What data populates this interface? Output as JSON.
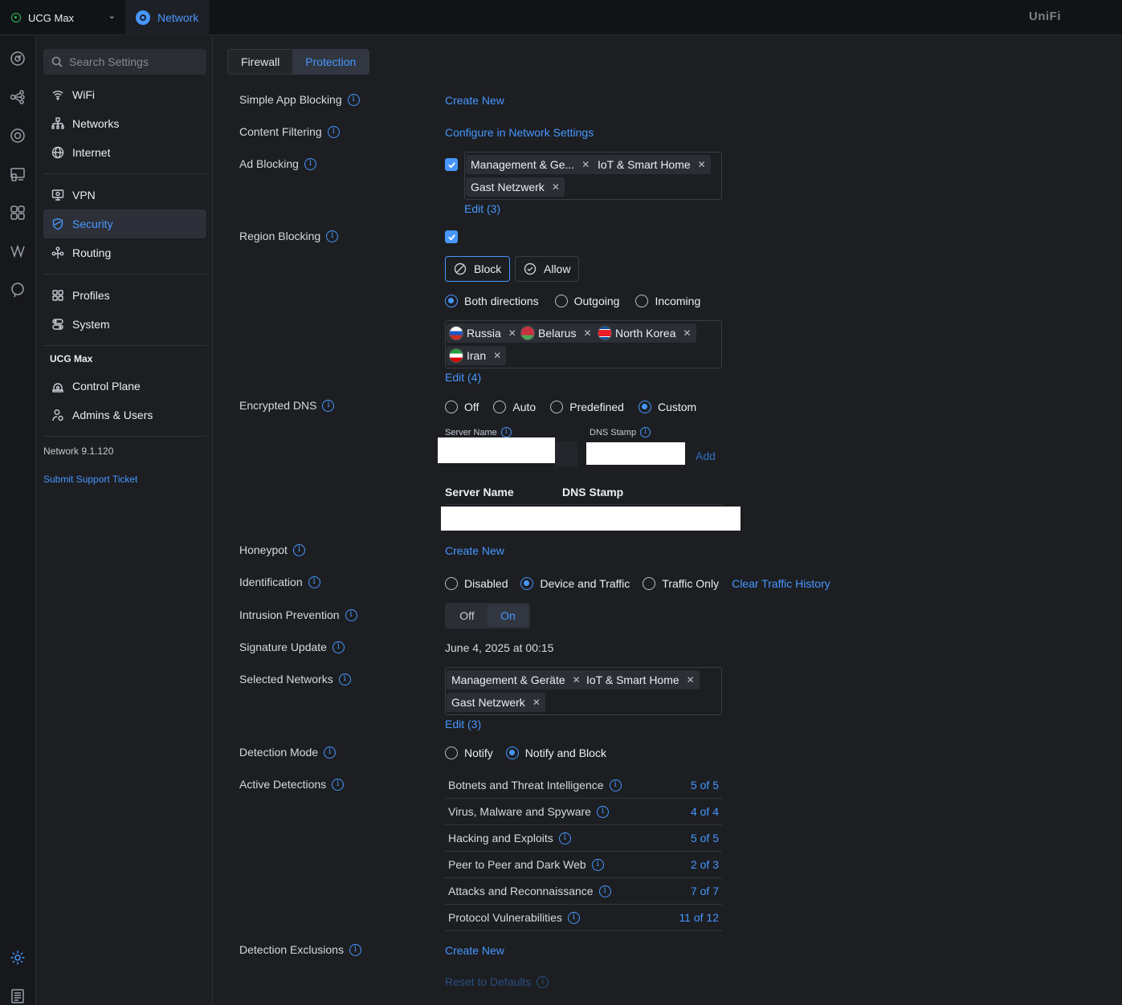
{
  "topbar": {
    "site_name": "UCG Max",
    "app_name": "Network",
    "brand": "UniFi"
  },
  "rail": {
    "icons": [
      "dashboard-icon",
      "topology-icon",
      "devices-icon",
      "client-devices-icon",
      "insights-icon",
      "radio-manager-icon",
      "alerts-icon",
      "settings-icon",
      "logs-icon"
    ]
  },
  "sidebar": {
    "search_placeholder": "Search Settings",
    "items": [
      {
        "label": "WiFi",
        "icon": "wifi-icon"
      },
      {
        "label": "Networks",
        "icon": "networks-icon"
      },
      {
        "label": "Internet",
        "icon": "globe-icon"
      },
      {
        "label": "VPN",
        "icon": "vpn-icon"
      },
      {
        "label": "Security",
        "icon": "shield-icon",
        "active": true
      },
      {
        "label": "Routing",
        "icon": "routing-icon"
      },
      {
        "label": "Profiles",
        "icon": "profiles-icon"
      },
      {
        "label": "System",
        "icon": "system-icon"
      }
    ],
    "section_title": "UCG Max",
    "ucg_items": [
      {
        "label": "Control Plane",
        "icon": "control-plane-icon"
      },
      {
        "label": "Admins & Users",
        "icon": "admins-icon"
      }
    ],
    "version": "Network 9.1.120",
    "support_link": "Submit Support Ticket"
  },
  "tabs": [
    {
      "label": "Firewall",
      "active": false
    },
    {
      "label": "Protection",
      "active": true
    }
  ],
  "settings": {
    "simple_app_blocking": {
      "label": "Simple App Blocking",
      "action": "Create New"
    },
    "content_filtering": {
      "label": "Content Filtering",
      "action": "Configure in Network Settings"
    },
    "ad_blocking": {
      "label": "Ad Blocking",
      "enabled": true,
      "networks": [
        "Management & Ge...",
        "IoT & Smart Home",
        "Gast Netzwerk"
      ],
      "edit": "Edit (3)"
    },
    "region_blocking": {
      "label": "Region Blocking",
      "enabled": true,
      "mode_block": "Block",
      "mode_allow": "Allow",
      "directions": [
        "Both directions",
        "Outgoing",
        "Incoming"
      ],
      "selected_direction": "Both directions",
      "countries": [
        "Russia",
        "Belarus",
        "North Korea",
        "Iran"
      ],
      "edit": "Edit (4)"
    },
    "encrypted_dns": {
      "label": "Encrypted DNS",
      "options": [
        "Off",
        "Auto",
        "Predefined",
        "Custom"
      ],
      "selected": "Custom",
      "server_name_label": "Server Name",
      "dns_stamp_label": "DNS Stamp",
      "add": "Add",
      "table_headers": [
        "Server Name",
        "DNS Stamp"
      ]
    },
    "honeypot": {
      "label": "Honeypot",
      "action": "Create New"
    },
    "identification": {
      "label": "Identification",
      "options": [
        "Disabled",
        "Device and Traffic",
        "Traffic Only"
      ],
      "selected": "Device and Traffic",
      "clear": "Clear Traffic History"
    },
    "intrusion_prevention": {
      "label": "Intrusion Prevention",
      "off": "Off",
      "on": "On",
      "state": "On"
    },
    "signature_update": {
      "label": "Signature Update",
      "value": "June 4, 2025 at 00:15"
    },
    "selected_networks": {
      "label": "Selected Networks",
      "networks": [
        "Management & Geräte",
        "IoT & Smart Home",
        "Gast Netzwerk"
      ],
      "edit": "Edit (3)"
    },
    "detection_mode": {
      "label": "Detection Mode",
      "options": [
        "Notify",
        "Notify and Block"
      ],
      "selected": "Notify and Block"
    },
    "active_detections": {
      "label": "Active Detections",
      "rows": [
        {
          "name": "Botnets and Threat Intelligence",
          "count": "5 of 5"
        },
        {
          "name": "Virus, Malware and Spyware",
          "count": "4 of 4"
        },
        {
          "name": "Hacking and Exploits",
          "count": "5 of 5"
        },
        {
          "name": "Peer to Peer and Dark Web",
          "count": "2 of 3"
        },
        {
          "name": "Attacks and Reconnaissance",
          "count": "7 of 7"
        },
        {
          "name": "Protocol Vulnerabilities",
          "count": "11 of 12"
        }
      ]
    },
    "detection_exclusions": {
      "label": "Detection Exclusions",
      "action": "Create New"
    },
    "reset": "Reset to Defaults"
  },
  "colors": {
    "accent": "#4797ff",
    "background": "#1c1e22",
    "topbar": "#121316"
  }
}
